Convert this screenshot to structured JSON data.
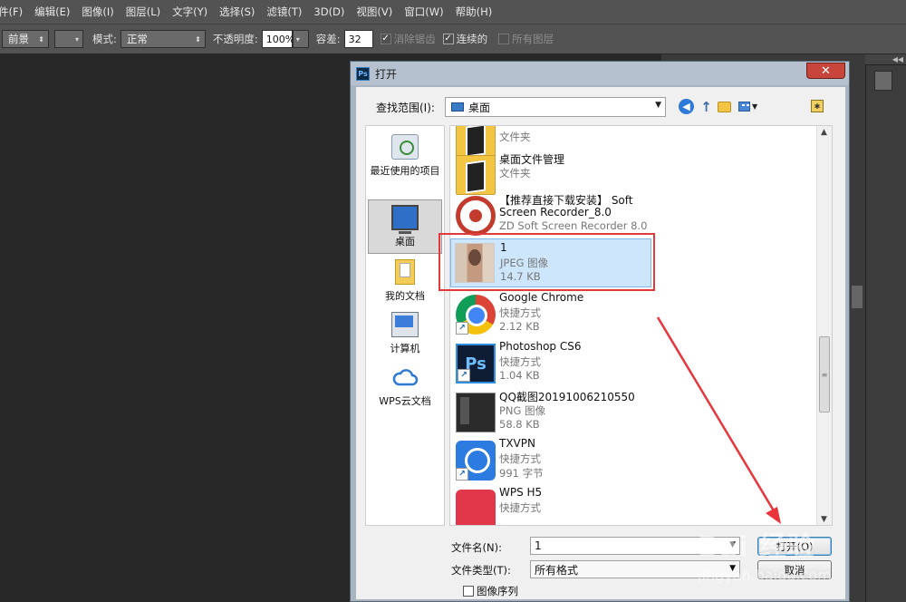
{
  "menu": [
    "件(F)",
    "编辑(E)",
    "图像(I)",
    "图层(L)",
    "文字(Y)",
    "选择(S)",
    "滤镜(T)",
    "3D(D)",
    "视图(V)",
    "窗口(W)",
    "帮助(H)"
  ],
  "options": {
    "fill_source": "前景",
    "mode_label": "模式:",
    "mode_value": "正常",
    "opacity_label": "不透明度:",
    "opacity_value": "100%",
    "tolerance_label": "容差:",
    "tolerance_value": "32",
    "antialias_label": "消除锯齿",
    "contiguous_label": "连续的",
    "all_layers_label": "所有图层"
  },
  "panel_tab": "◀◀",
  "dialog": {
    "title": "打开",
    "ps_badge": "Ps",
    "close": "✕",
    "lookin_label": "查找范围(I):",
    "lookin_value": "桌面",
    "places": [
      {
        "label": "最近使用的项目"
      },
      {
        "label": "桌面"
      },
      {
        "label": "我的文档"
      },
      {
        "label": "计算机"
      },
      {
        "label": "WPS云文档"
      }
    ],
    "files": [
      {
        "name": "",
        "type": "文件夹",
        "size": ""
      },
      {
        "name": "桌面文件管理",
        "type": "文件夹",
        "size": ""
      },
      {
        "name": "【推荐直接下载安装】 Soft",
        "name2": "Screen Recorder_8.0",
        "type": "ZD Soft Screen Recorder 8.0",
        "size": ""
      },
      {
        "name": "1",
        "type": "JPEG 图像",
        "size": "14.7 KB"
      },
      {
        "name": "Google Chrome",
        "type": "快捷方式",
        "size": "2.12 KB"
      },
      {
        "name": "Photoshop CS6",
        "type": "快捷方式",
        "size": "1.04 KB"
      },
      {
        "name": "QQ截图20191006210550",
        "type": "PNG 图像",
        "size": "58.8 KB"
      },
      {
        "name": "TXVPN",
        "type": "快捷方式",
        "size": "991 字节"
      },
      {
        "name": "WPS H5",
        "type": "快捷方式",
        "size": ""
      }
    ],
    "filename_label": "文件名(N):",
    "filename_value": "1",
    "filetype_label": "文件类型(T):",
    "filetype_value": "所有格式",
    "open_button": "打开(O)",
    "cancel_button": "取消",
    "image_sequence_label": "图像序列"
  },
  "watermark": {
    "text": "Bai 经验",
    "url": "jingyan.baidu.com"
  }
}
